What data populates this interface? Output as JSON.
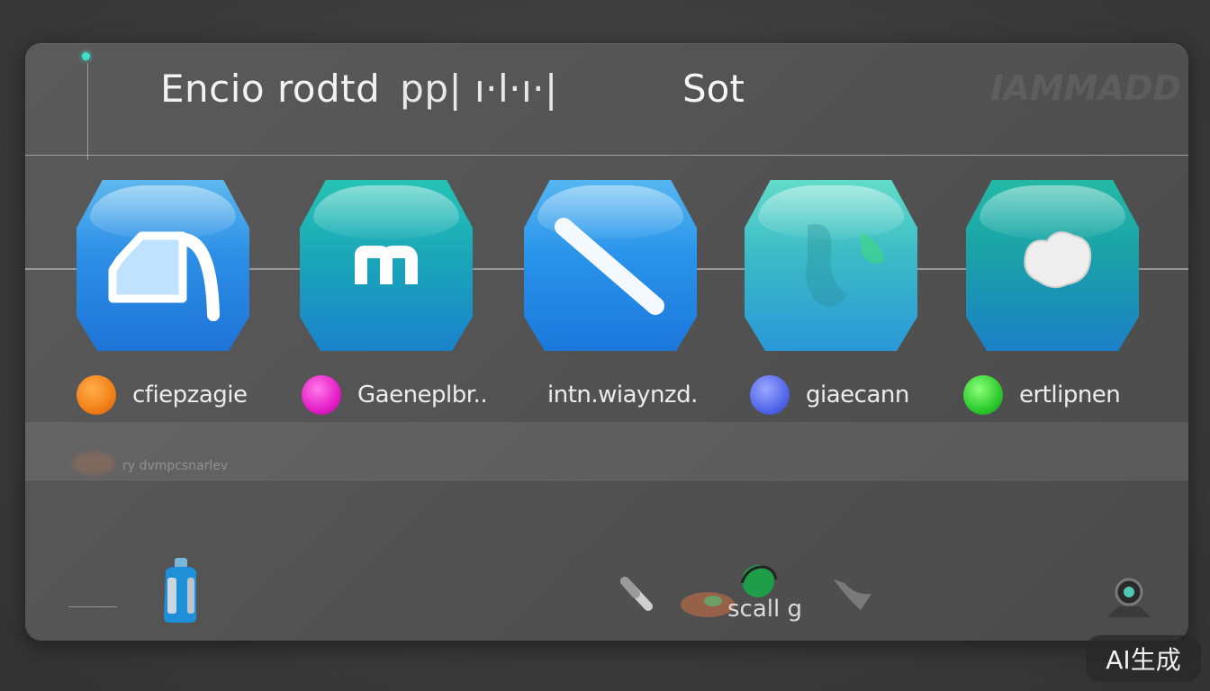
{
  "header": {
    "title": "Encio rodtd",
    "title_mid": "pp| ı·l·ı·|",
    "title_right": "Sot",
    "watermark": "IAMMADD"
  },
  "apps": [
    {
      "label": "cfiepzagie",
      "dot_color": "#f28018",
      "icon": "box-arrow-icon"
    },
    {
      "label": "Gaeneplbr..",
      "dot_color": "#e61ec8",
      "icon": "m-letter-icon"
    },
    {
      "label": "intn.wiaynzd.",
      "dot_color": "",
      "icon": "diagonal-slash-icon"
    },
    {
      "label": "giaecann",
      "dot_color": "#5468ea",
      "icon": "globe-map-icon"
    },
    {
      "label": "ertlipnen",
      "dot_color": "#2ecb2e",
      "icon": "cloud-blob-icon"
    }
  ],
  "band": {
    "text": "ry dvmpcsnarlev"
  },
  "bottom": {
    "scall_text": "scall g"
  },
  "badge": {
    "text": "AI生成"
  }
}
